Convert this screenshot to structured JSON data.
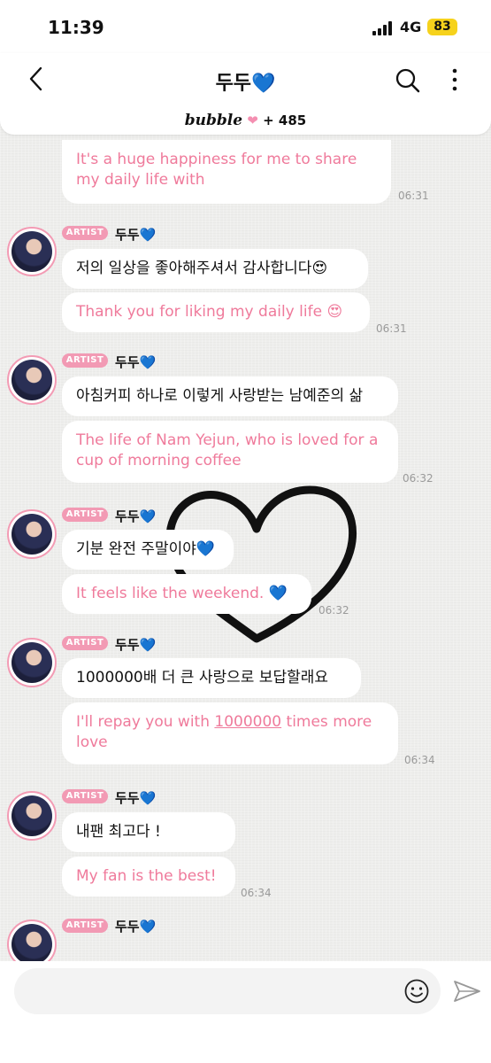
{
  "status_bar": {
    "time": "11:39",
    "network": "4G",
    "battery": "83"
  },
  "header": {
    "title": "두두💙",
    "brand": "bubble",
    "count": "+ 485"
  },
  "messages": [
    {
      "en": "It's a huge happiness for me to share my daily life with",
      "time": "06:31"
    },
    {
      "badge": "ARTIST",
      "sender": "두두💙",
      "ko": "저의 일상을 좋아해주셔서 감사합니다😍",
      "en": "Thank you for liking my daily life 😍",
      "time": "06:31"
    },
    {
      "badge": "ARTIST",
      "sender": "두두💙",
      "ko": "아침커피 하나로 이렇게 사랑받는 남예준의 삶",
      "en": "The life of Nam Yejun, who is loved for a cup of morning coffee",
      "time": "06:32"
    },
    {
      "badge": "ARTIST",
      "sender": "두두💙",
      "ko": "기분 완전 주말이야💙",
      "en": "It feels like the weekend. 💙",
      "time": "06:32"
    },
    {
      "badge": "ARTIST",
      "sender": "두두💙",
      "ko": "1000000배 더 큰 사랑으로 보답할래요",
      "en_pre": "I'll repay you with ",
      "en_link": "1000000",
      "en_post": " times more love",
      "time": "06:34"
    },
    {
      "badge": "ARTIST",
      "sender": "두두💙",
      "ko": "내팬 최고다 !",
      "en": "My fan is the best!",
      "time": "06:34"
    },
    {
      "badge": "ARTIST",
      "sender": "두두💙"
    }
  ],
  "icons": {
    "back": "back-arrow-icon",
    "search": "search-icon",
    "more": "more-vertical-icon",
    "emoji": "smile-icon",
    "send": "send-icon"
  },
  "colors": {
    "accent_pink": "#ef7a9b",
    "badge_pink": "#f29ab4",
    "battery": "#f6d21c"
  }
}
